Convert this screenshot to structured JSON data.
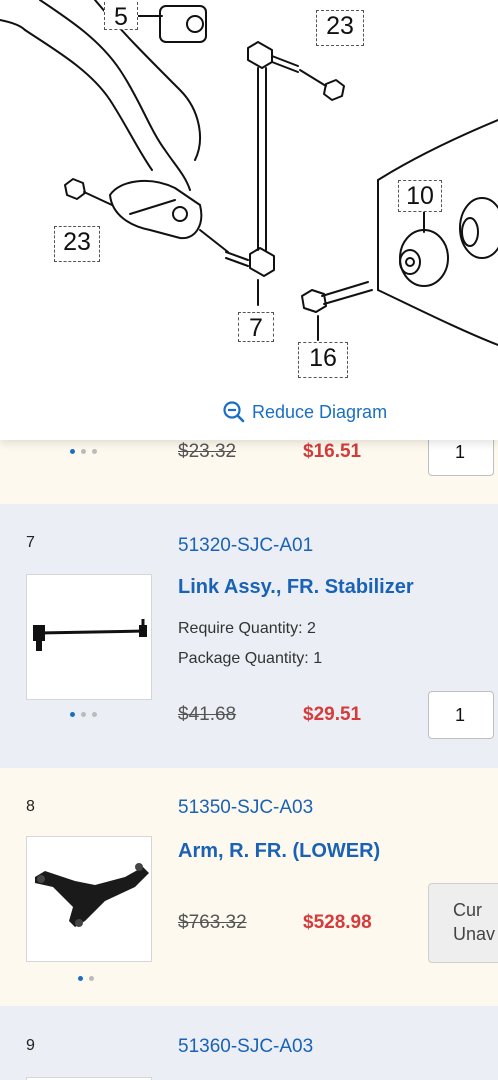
{
  "diagram": {
    "callouts": [
      "5",
      "23",
      "23",
      "10",
      "7",
      "16"
    ],
    "reduce_label": "Reduce Diagram"
  },
  "items": [
    {
      "dots": 3,
      "old_price": "$23.32",
      "new_price": "$16.51",
      "qty": "1"
    },
    {
      "index": "7",
      "part_number": "51320-SJC-A01",
      "name": "Link Assy., FR. Stabilizer",
      "require_qty": "Require Quantity: 2",
      "package_qty": "Package Quantity: 1",
      "dots": 3,
      "old_price": "$41.68",
      "new_price": "$29.51",
      "qty": "1"
    },
    {
      "index": "8",
      "part_number": "51350-SJC-A03",
      "name": "Arm, R. FR. (LOWER)",
      "dots": 2,
      "old_price": "$763.32",
      "new_price": "$528.98",
      "status_line1": "Cur",
      "status_line2": "Unav"
    },
    {
      "index": "9",
      "part_number": "51360-SJC-A03"
    }
  ],
  "colors": {
    "link_blue": "#1a62b5",
    "sale_red": "#d63b3b",
    "cream_bg": "#fdf9ee",
    "blue_bg": "#ebeff5"
  }
}
